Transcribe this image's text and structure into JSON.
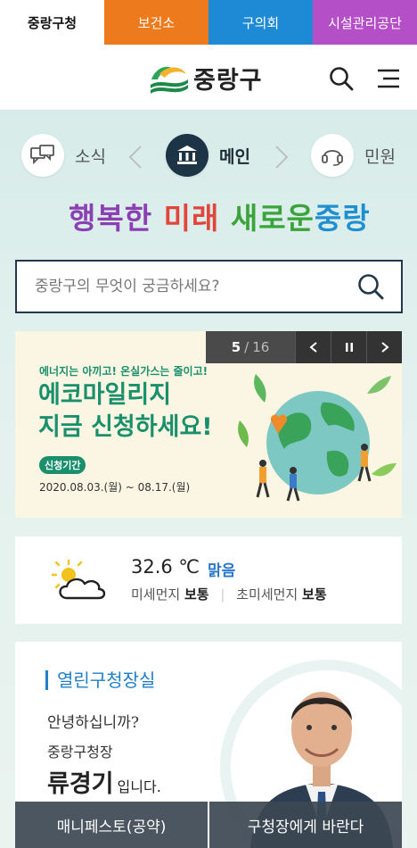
{
  "topbar": {
    "tabs": [
      {
        "label": "중랑구청"
      },
      {
        "label": "보건소"
      },
      {
        "label": "구의회"
      },
      {
        "label": "시설관리공단"
      }
    ],
    "colors": {
      "health": "#ed7a1c",
      "council": "#1e8ad6",
      "facility": "#b54fc7"
    }
  },
  "header": {
    "logo_text": "중랑구",
    "search_icon": "search-icon",
    "menu_icon": "menu-icon"
  },
  "quicknav": {
    "items": [
      {
        "label": "소식",
        "icon": "chat-bubbles-icon"
      },
      {
        "label": "메인",
        "icon": "building-icon"
      },
      {
        "label": "민원",
        "icon": "headset-icon"
      }
    ]
  },
  "slogan": {
    "parts": [
      "행복한",
      "미래",
      "새로운",
      "중랑"
    ]
  },
  "search": {
    "placeholder": "중랑구의 무엇이 궁금하세요?"
  },
  "banner": {
    "current": "5",
    "separator": "/",
    "total": "16",
    "subtitle": "에너지는 아끼고! 온실가스는 줄이고!",
    "title_line1": "에코마일리지",
    "title_line2": "지금 신청하세요!",
    "chip": "신청기간",
    "date": "2020.08.03.(월) ~ 08.17.(월)"
  },
  "weather": {
    "icon": "partly-cloudy-icon",
    "temp": "32.6 ℃",
    "condition": "맑음",
    "dust_label": "미세먼지",
    "dust_value": "보통",
    "ultra_label": "초미세먼지",
    "ultra_value": "보통",
    "accent": "#2a78c8"
  },
  "mayor": {
    "title": "열린구청장실",
    "greeting": "안녕하십니까?",
    "role": "중랑구청장",
    "name": "류경기",
    "name_tail": "입니다.",
    "btn_manifesto": "매니페스토(공약)",
    "btn_wish": "구청장에게 바란다"
  }
}
